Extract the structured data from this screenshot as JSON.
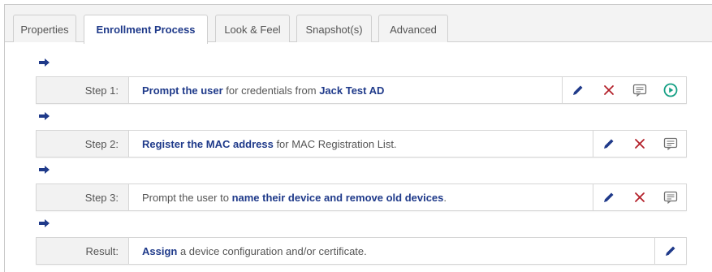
{
  "tabs": [
    {
      "label": "Properties",
      "active": false
    },
    {
      "label": "Enrollment Process",
      "active": true
    },
    {
      "label": "Look & Feel",
      "active": false
    },
    {
      "label": "Snapshot(s)",
      "active": false
    },
    {
      "label": "Advanced",
      "active": false
    }
  ],
  "steps": [
    {
      "label": "Step 1:",
      "parts": [
        {
          "text": "Prompt the user",
          "bold": true
        },
        {
          "text": " for credentials from ",
          "bold": false
        },
        {
          "text": "Jack Test AD",
          "bold": true
        }
      ],
      "actions": [
        "edit-icon",
        "delete-icon",
        "comment-icon",
        "play-icon"
      ]
    },
    {
      "label": "Step 2:",
      "parts": [
        {
          "text": "Register the MAC address",
          "bold": true
        },
        {
          "text": " for MAC Registration List.",
          "bold": false
        }
      ],
      "actions": [
        "edit-icon",
        "delete-icon",
        "comment-icon"
      ]
    },
    {
      "label": "Step 3:",
      "parts": [
        {
          "text": "Prompt the user to ",
          "bold": false
        },
        {
          "text": "name their device and remove old devices",
          "bold": true
        },
        {
          "text": ".",
          "bold": false
        }
      ],
      "actions": [
        "edit-icon",
        "delete-icon",
        "comment-icon"
      ]
    },
    {
      "label": "Result:",
      "parts": [
        {
          "text": "Assign",
          "bold": true
        },
        {
          "text": " a device configuration and/or certificate.",
          "bold": false
        }
      ],
      "actions": [
        "edit-icon"
      ]
    }
  ],
  "colors": {
    "accent_text": "#1f3a8a",
    "arrow": "#1f3a8a",
    "edit_icon": "#1f3a8a",
    "delete_icon": "#b3202a",
    "comment_icon": "#707070",
    "play_icon": "#16a085"
  }
}
